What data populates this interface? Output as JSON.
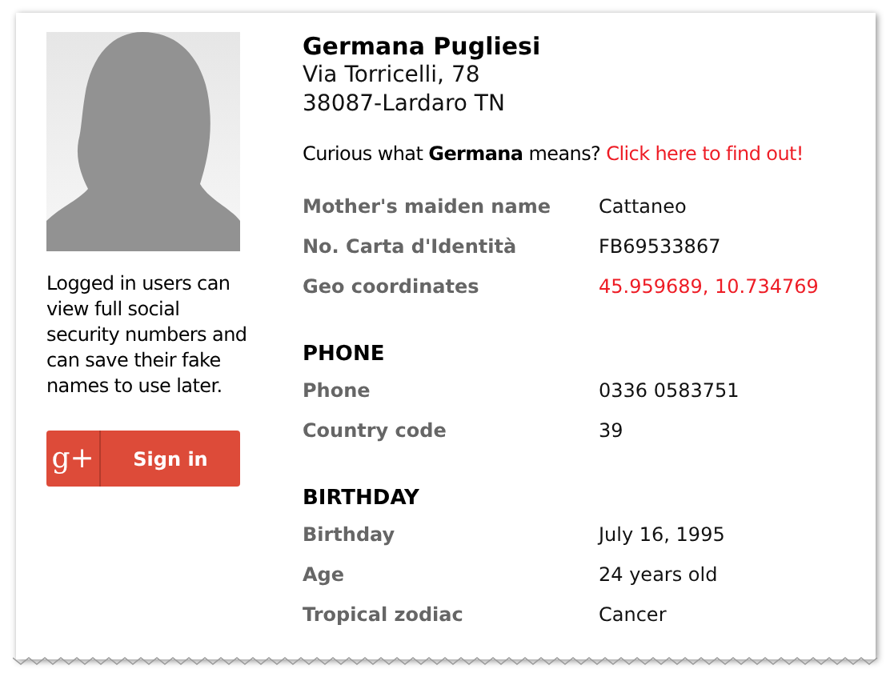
{
  "sidebar": {
    "login_note": "Logged in users can view full social security numbers and can save their fake names to use later.",
    "sign_in_button": {
      "icon_text": "g+",
      "label": "Sign in"
    }
  },
  "person": {
    "name": "Germana Pugliesi",
    "address_lines": [
      "Via Torricelli, 78",
      "38087-Lardaro TN"
    ],
    "curious": "Curious what **Germana** means?",
    "curious_link": "Click here to find out!"
  },
  "sections": [
    {
      "rows": [
        {
          "label": "Mother's maiden name",
          "value": "Cattaneo",
          "kind": "text"
        },
        {
          "label": "No. Carta d'Identità",
          "value": "FB69533867",
          "kind": "text"
        },
        {
          "label": "Geo coordinates",
          "value": "45.959689, 10.734769",
          "kind": "link"
        }
      ]
    },
    {
      "heading": "PHONE",
      "rows": [
        {
          "label": "Phone",
          "value": "0336 0583751",
          "kind": "text"
        },
        {
          "label": "Country code",
          "value": "39",
          "kind": "text"
        }
      ]
    },
    {
      "heading": "BIRTHDAY",
      "rows": [
        {
          "label": "Birthday",
          "value": "July 16, 1995",
          "kind": "text"
        },
        {
          "label": "Age",
          "value": "24 years old",
          "kind": "text"
        },
        {
          "label": "Tropical zodiac",
          "value": "Cancer",
          "kind": "text"
        }
      ]
    }
  ]
}
